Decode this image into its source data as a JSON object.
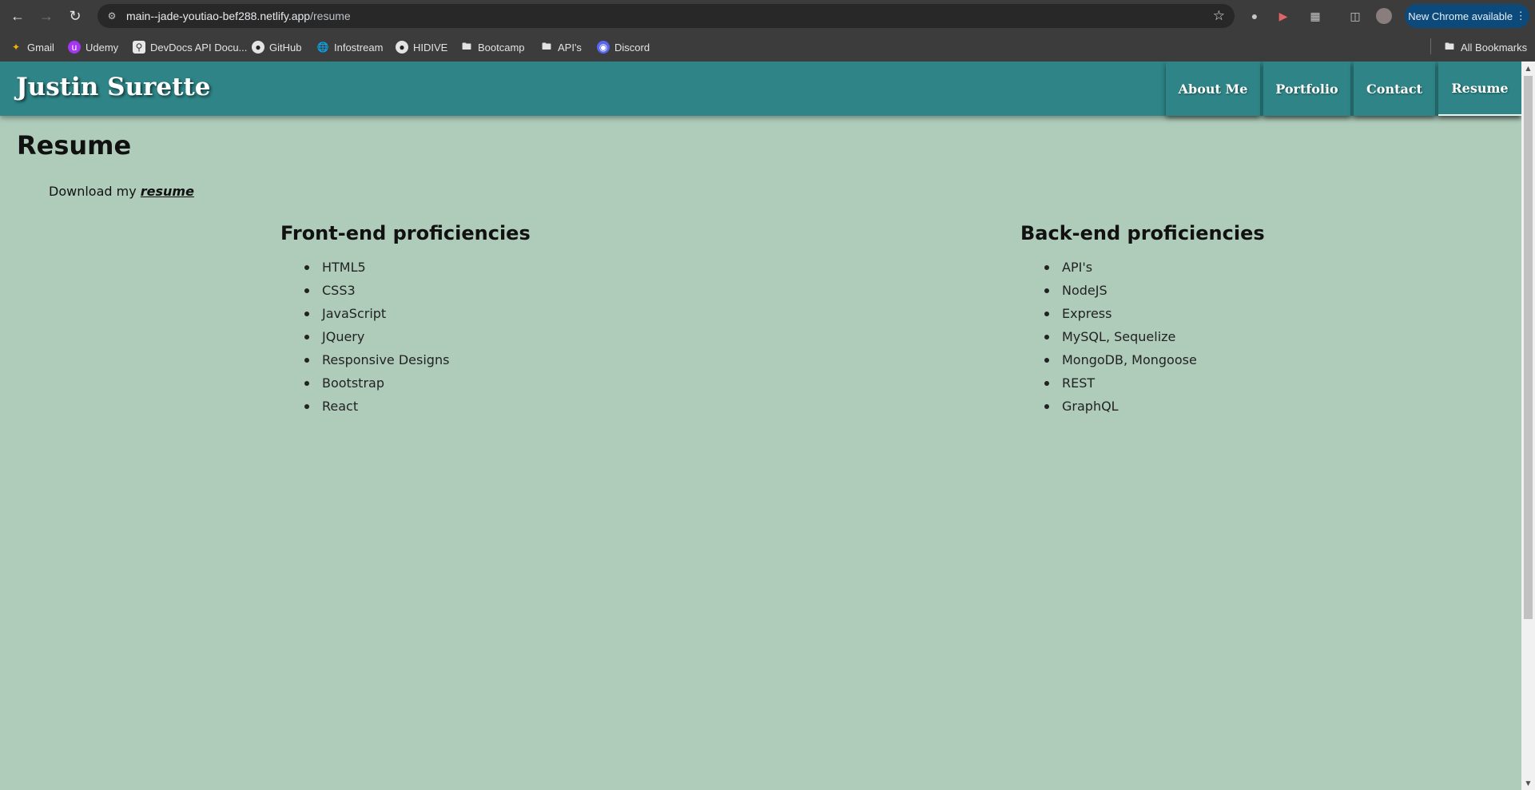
{
  "browser": {
    "url_host": "main--jade-youtiao-bef288.netlify.app",
    "url_path": "/resume",
    "update_label": "New Chrome available",
    "bookmarks": [
      {
        "label": "Gmail",
        "icon": "gmail-icon"
      },
      {
        "label": "Udemy",
        "icon": "udemy-icon"
      },
      {
        "label": "DevDocs API Docu...",
        "icon": "devdocs-icon"
      },
      {
        "label": "GitHub",
        "icon": "github-icon"
      },
      {
        "label": "Infostream",
        "icon": "globe-icon"
      },
      {
        "label": "HIDIVE",
        "icon": "github-icon"
      },
      {
        "label": "Bootcamp",
        "icon": "folder-icon"
      },
      {
        "label": "API's",
        "icon": "folder-icon"
      },
      {
        "label": "Discord",
        "icon": "discord-icon"
      }
    ],
    "all_bookmarks_label": "All Bookmarks"
  },
  "site": {
    "name": "Justin Surette",
    "nav": [
      "About Me",
      "Portfolio",
      "Contact",
      "Resume"
    ],
    "active_nav": "Resume"
  },
  "resume": {
    "title": "Resume",
    "download_prefix": "Download my ",
    "download_link": "resume",
    "front_end": {
      "heading": "Front-end proficiencies",
      "items": [
        "HTML5",
        "CSS3",
        "JavaScript",
        "JQuery",
        "Responsive Designs",
        "Bootstrap",
        "React"
      ]
    },
    "back_end": {
      "heading": "Back-end proficiencies",
      "items": [
        "API's",
        "NodeJS",
        "Express",
        "MySQL, Sequelize",
        "MongoDB, Mongoose",
        "REST",
        "GraphQL"
      ]
    }
  },
  "colors": {
    "header": "#2e8486",
    "page_background": "#afccbb",
    "chrome_bar": "#3c3c3c"
  }
}
